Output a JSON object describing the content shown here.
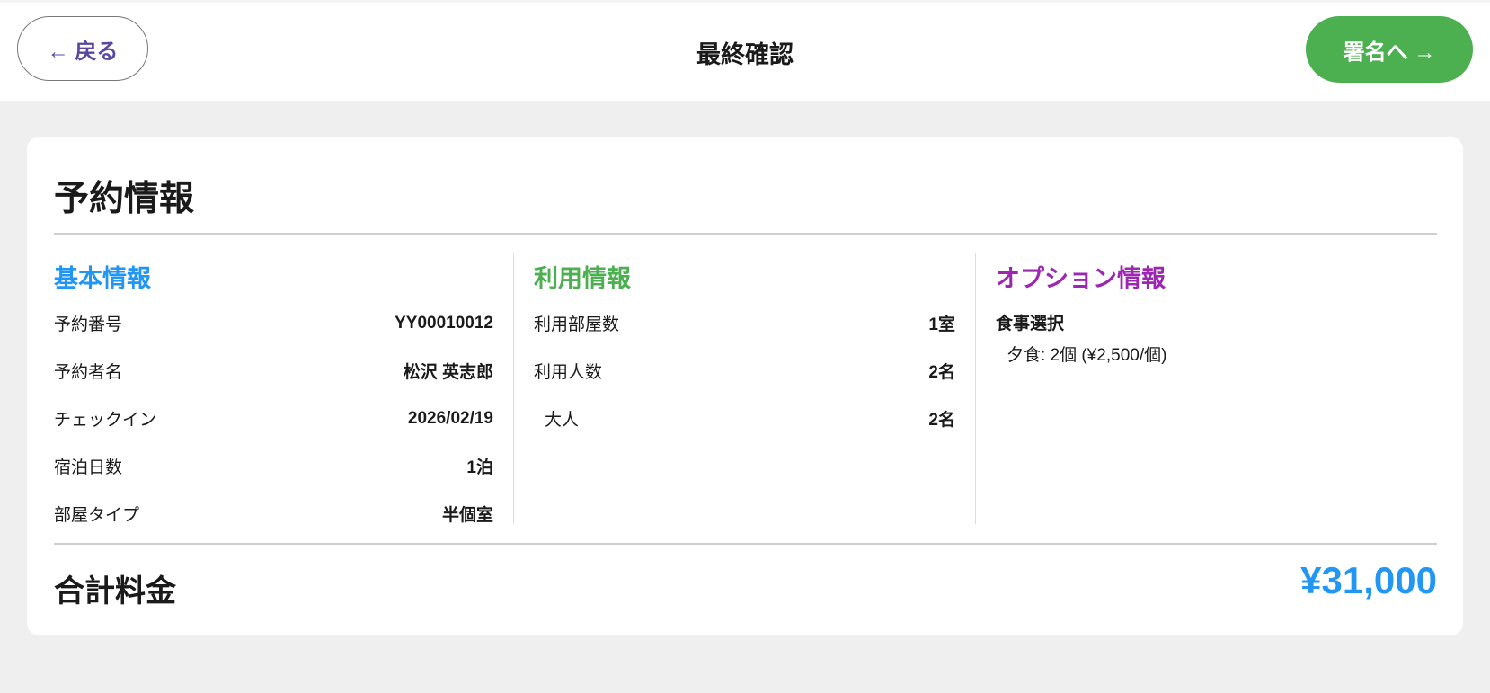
{
  "header": {
    "back_label": "← 戻る",
    "title": "最終確認",
    "next_label": "署名へ →"
  },
  "card": {
    "title": "予約情報",
    "basic": {
      "heading": "基本情報",
      "rows": [
        {
          "label": "予約番号",
          "value": "YY00010012"
        },
        {
          "label": "予約者名",
          "value": "松沢 英志郎"
        },
        {
          "label": "チェックイン",
          "value": "2026/02/19"
        },
        {
          "label": "宿泊日数",
          "value": "1泊"
        },
        {
          "label": "部屋タイプ",
          "value": "半個室"
        }
      ]
    },
    "usage": {
      "heading": "利用情報",
      "rows": [
        {
          "label": "利用部屋数",
          "value": "1室"
        },
        {
          "label": "利用人数",
          "value": "2名"
        },
        {
          "label": "大人",
          "value": "2名"
        }
      ]
    },
    "options": {
      "heading": "オプション情報",
      "meal_heading": "食事選択",
      "items": [
        "夕食: 2個 (¥2,500/個)"
      ]
    },
    "total": {
      "label": "合計料金",
      "value": "¥31,000"
    }
  },
  "colors": {
    "blue": "#2196f3",
    "green": "#4caf50",
    "purple": "#9c27b0"
  }
}
